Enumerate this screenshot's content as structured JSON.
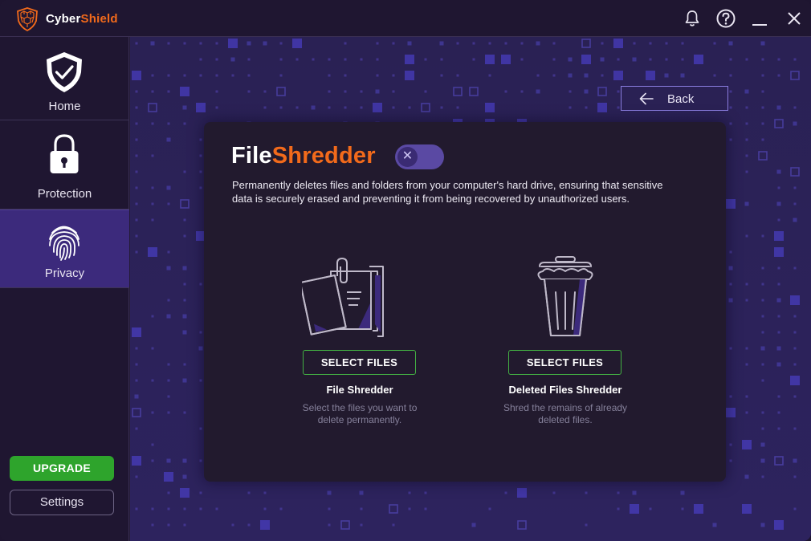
{
  "app": {
    "brand_part1": "Cyber",
    "brand_part2": "Shield",
    "accent_color": "#f26a1b",
    "icons": {
      "logo": "shield-logo-icon",
      "notifications": "bell-icon",
      "help": "help-icon",
      "minimize": "minimize-icon",
      "close": "close-icon"
    }
  },
  "sidebar": {
    "items": [
      {
        "label": "Home",
        "icon": "shield-check-icon"
      },
      {
        "label": "Protection",
        "icon": "lock-icon"
      },
      {
        "label": "Privacy",
        "icon": "fingerprint-icon",
        "active": true
      }
    ],
    "upgrade_label": "UPGRADE",
    "settings_label": "Settings"
  },
  "main": {
    "back_label": "Back",
    "title_part1": "File",
    "title_part2": "Shredder",
    "toggle_state": "off",
    "description": "Permanently deletes files and folders from your computer's hard drive, ensuring that sensitive data is securely erased and preventing it from being recovered by unauthorized users.",
    "cards": [
      {
        "button_label": "SELECT FILES",
        "title": "File Shredder",
        "description": "Select the files you want to delete permanently.",
        "icon": "documents-icon"
      },
      {
        "button_label": "SELECT FILES",
        "title": "Deleted Files Shredder",
        "description": "Shred the remains of already deleted files.",
        "icon": "trash-bin-icon"
      }
    ]
  }
}
